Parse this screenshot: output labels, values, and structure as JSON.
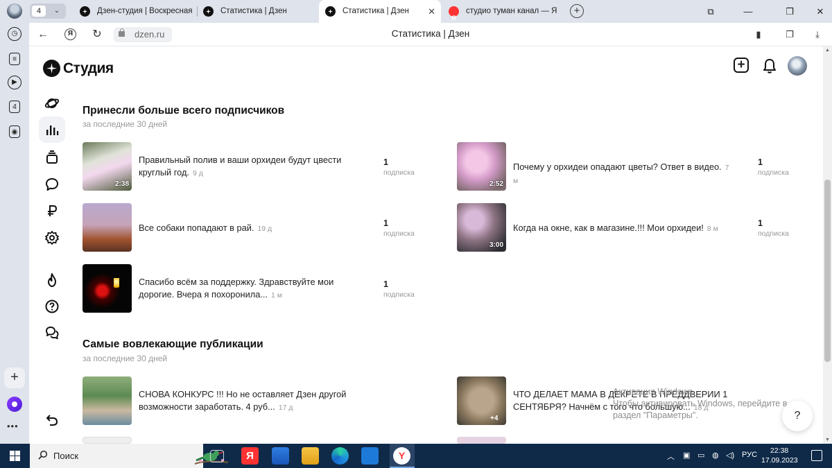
{
  "browser": {
    "tab_count": "4",
    "tabs": [
      {
        "label": "Дзен-студия | Воскресная",
        "icon": "dzen-icon"
      },
      {
        "label": "Статистика | Дзен",
        "icon": "dzen-icon"
      },
      {
        "label": "Статистика | Дзен",
        "icon": "dzen-icon",
        "active": true
      },
      {
        "label": "студио туман канал — Янд",
        "icon": "yandex-icon"
      }
    ],
    "url": "dzen.ru",
    "page_title": "Статистика | Дзен"
  },
  "studio": {
    "logo_text": "Студия"
  },
  "sections": [
    {
      "title": "Принесли больше всего подписчиков",
      "subtitle": "за последние 30 дней",
      "items": [
        {
          "title": "Правильный полив и ваши орхидеи будут цвести круглый год.",
          "age": "9 д",
          "duration": "2:38",
          "value": "1",
          "label": "подписка"
        },
        {
          "title": "Почему у орхидеи опадают цветы? Ответ в видео.",
          "age": "7 м",
          "duration": "2:52",
          "value": "1",
          "label": "подписка"
        },
        {
          "title": "Все собаки попадают в рай.",
          "age": "19 д",
          "duration": "",
          "value": "1",
          "label": "подписка"
        },
        {
          "title": "Когда на окне, как в магазине.!!! Мои орхидеи!",
          "age": "8 м",
          "duration": "3:00",
          "value": "1",
          "label": "подписка"
        },
        {
          "title": "Спасибо всём за поддержку. Здравствуйте мои дорогие. Вчера я похоронила...",
          "age": "1 м",
          "duration": "",
          "value": "1",
          "label": "подписка"
        }
      ]
    },
    {
      "title": "Самые вовлекающие публикации",
      "subtitle": "за последние 30 дней",
      "items": [
        {
          "title": "СНОВА КОНКУРС !!! Но не оставляет Дзен другой возможности заработать. 4 руб...",
          "age": "17 д"
        },
        {
          "title": "ЧТО ДЕЛАЕТ МАМА В ДЕКРЕТЕ В ПРЕДДВЕРИИ 1 СЕНТЯБРЯ? Начнём с того что большую...",
          "age": "18 д",
          "badge": "+4"
        }
      ]
    }
  ],
  "watermark": {
    "line1": "Активация Windows",
    "line2": "Чтобы активировать Windows, перейдите в",
    "line3": "раздел \"Параметры\"."
  },
  "help": "?",
  "taskbar": {
    "search_placeholder": "Поиск",
    "lang": "РУС",
    "time": "22:38",
    "date": "17.09.2023"
  }
}
